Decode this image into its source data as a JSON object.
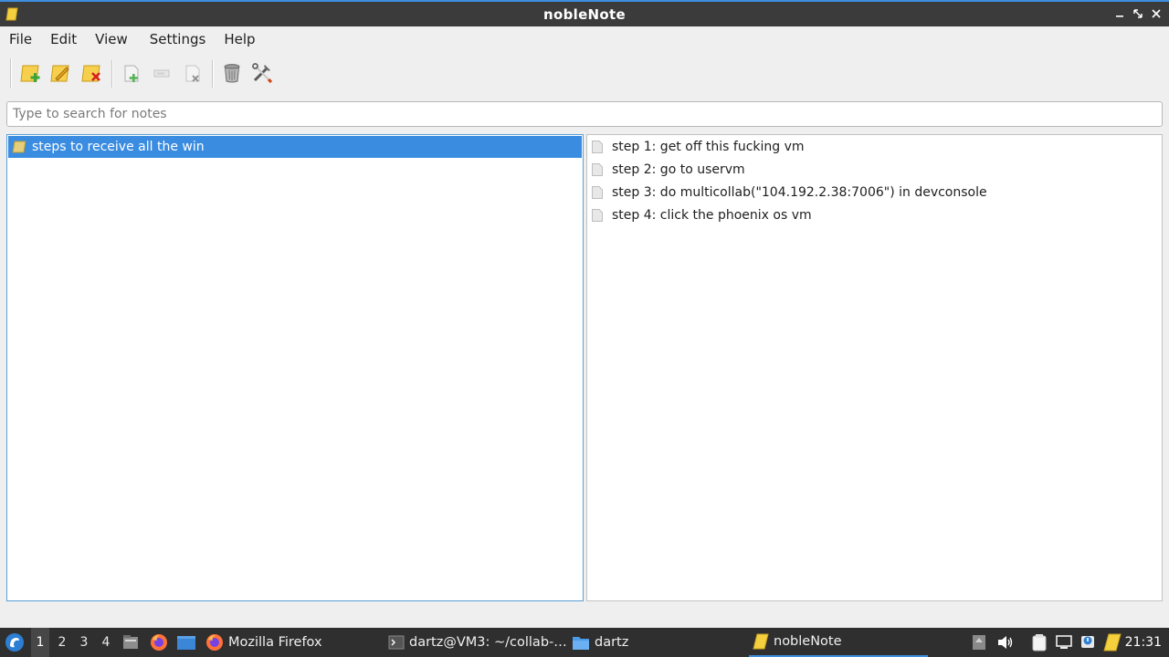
{
  "window": {
    "title": "nobleNote"
  },
  "menu": [
    "File",
    "Edit",
    "View",
    "Settings",
    "Help"
  ],
  "toolbar": {
    "buttons": [
      "new-folder-icon",
      "rename-folder-icon",
      "delete-folder-icon",
      "new-note-icon",
      "rename-note-icon",
      "delete-note-icon",
      "trash-icon",
      "tools-icon"
    ]
  },
  "search": {
    "placeholder": "Type to search for notes",
    "value": ""
  },
  "folders": [
    {
      "label": "steps to receive all the win",
      "selected": true
    }
  ],
  "notes": [
    {
      "label": "step 1: get off this fucking vm"
    },
    {
      "label": "step 2: go to uservm"
    },
    {
      "label": "step 3: do multicollab(\"104.192.2.38:7006\") in devconsole"
    },
    {
      "label": "step 4: click the phoenix os vm"
    }
  ],
  "taskbar": {
    "workspaces": [
      "1",
      "2",
      "3",
      "4"
    ],
    "active_workspace": "1",
    "tasks": [
      {
        "label": "Mozilla Firefox",
        "icon": "firefox-icon"
      },
      {
        "label": "dartz@VM3: ~/collab-…",
        "icon": "terminal-icon"
      },
      {
        "label": "dartz",
        "icon": "folder-icon"
      },
      {
        "label": "nobleNote",
        "icon": "notes-icon",
        "active": true
      }
    ],
    "clock": "21:31"
  },
  "colors": {
    "accent": "#3a8ce0",
    "titlebar": "#3b3b3b",
    "taskbar": "#2f2f2f",
    "folder_yellow": "#f0c419"
  }
}
